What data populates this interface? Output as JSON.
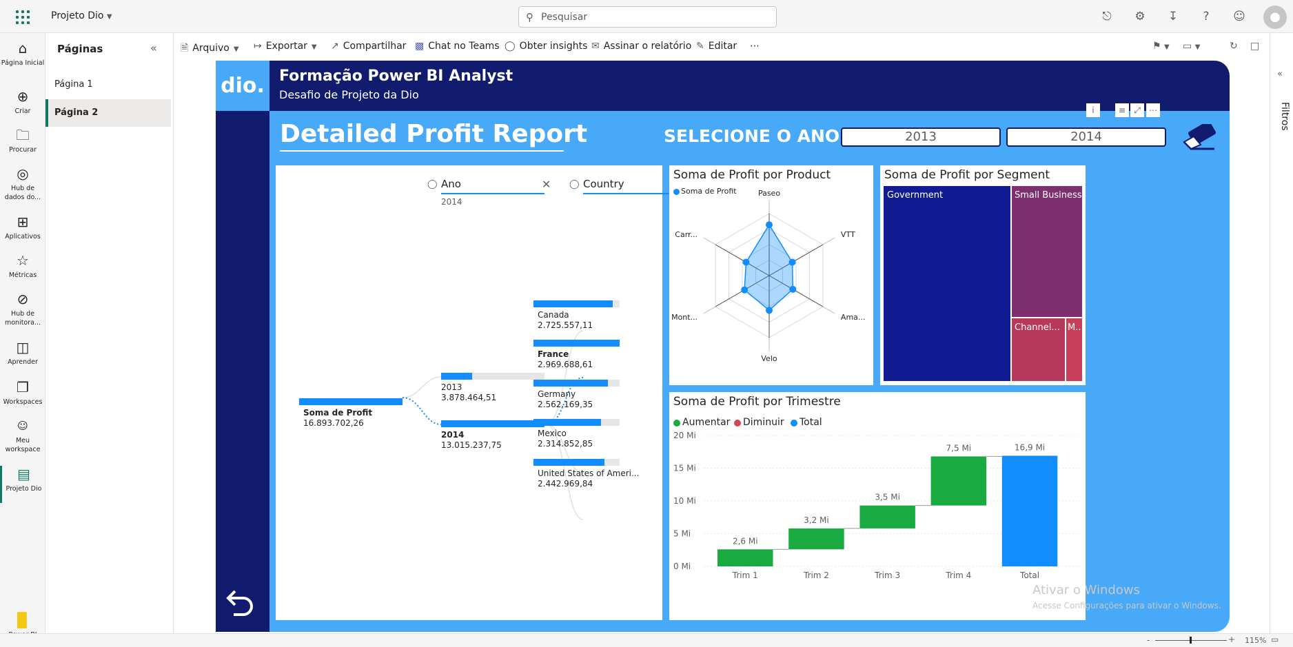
{
  "topbar": {
    "workspace": "Projeto Dio",
    "search_placeholder": "Pesquisar"
  },
  "rail": [
    {
      "icon": "home-icon",
      "label": "Página Inicial"
    },
    {
      "icon": "plus-icon",
      "label": "Criar"
    },
    {
      "icon": "folder-icon",
      "label": "Procurar"
    },
    {
      "icon": "data-hub-icon",
      "label": "Hub de dados do..."
    },
    {
      "icon": "apps-icon",
      "label": "Aplicativos"
    },
    {
      "icon": "trophy-icon",
      "label": "Métricas"
    },
    {
      "icon": "monitor-hub-icon",
      "label": "Hub de monitora..."
    },
    {
      "icon": "book-icon",
      "label": "Aprender"
    },
    {
      "icon": "workspaces-icon",
      "label": "Workspaces"
    },
    {
      "icon": "user-icon",
      "label": "Meu workspace"
    },
    {
      "icon": "report-icon",
      "label": "Projeto Dio"
    }
  ],
  "rail_footer": "Power BI",
  "pages": {
    "title": "Páginas",
    "items": [
      "Página 1",
      "Página 2"
    ]
  },
  "toolbar": {
    "arquivo": "Arquivo",
    "exportar": "Exportar",
    "compartilhar": "Compartilhar",
    "chat": "Chat no Teams",
    "insights": "Obter insights",
    "assinar": "Assinar o relatório",
    "editar": "Editar"
  },
  "filters_label": "Filtros",
  "status": {
    "zoom": "115%"
  },
  "report": {
    "logo": "dio.",
    "title": "Formação Power BI Analyst",
    "subtitle": "Desafio de Projeto da Dio",
    "heading": "Detailed Profit Report",
    "select_label": "SELECIONE O ANO:",
    "years": [
      "2013",
      "2014"
    ],
    "decomposition": {
      "header_ano": "Ano",
      "header_ano_sel": "2014",
      "header_country": "Country",
      "root_label": "Soma de Profit",
      "root_value": "16.893.702,26",
      "years": [
        {
          "label": "2013",
          "value": "3.878.464,51"
        },
        {
          "label": "2014",
          "value": "13.015.237,75"
        }
      ],
      "countries": [
        {
          "label": "Canada",
          "value": "2.725.557,11",
          "share": 0.92
        },
        {
          "label": "France",
          "value": "2.969.688,61",
          "share": 1.0
        },
        {
          "label": "Germany",
          "value": "2.562.169,35",
          "share": 0.86
        },
        {
          "label": "Mexico",
          "value": "2.314.852,85",
          "share": 0.78
        },
        {
          "label": "United States of Ameri...",
          "value": "2.442.969,84",
          "share": 0.82
        }
      ]
    },
    "radar": {
      "title": "Soma de Profit por Product",
      "legend": "Soma de Profit"
    },
    "treemap": {
      "title": "Soma de Profit por Segment",
      "labels": [
        "Government",
        "Small Business",
        "Channel...",
        "M..."
      ]
    },
    "waterfall": {
      "title": "Soma de Profit por Trimestre",
      "legend": [
        "Aumentar",
        "Diminuir",
        "Total"
      ]
    }
  },
  "watermark": {
    "line1": "Ativar o Windows",
    "line2": "Acesse Configurações para ativar o Windows."
  },
  "chart_data": [
    {
      "type": "radar",
      "title": "Soma de Profit por Product",
      "series": [
        {
          "name": "Soma de Profit",
          "values": [
            0.82,
            0.43,
            0.44,
            0.56,
            0.46,
            0.43
          ]
        }
      ],
      "categories": [
        "Paseo",
        "VTT",
        "Ama...",
        "Velo",
        "Mont...",
        "Carr..."
      ]
    },
    {
      "type": "treemap",
      "title": "Soma de Profit por Segment",
      "categories": [
        "Government",
        "Small Business",
        "Channel...",
        "M..."
      ],
      "values": [
        0.6,
        0.26,
        0.09,
        0.05
      ]
    },
    {
      "type": "waterfall",
      "title": "Soma de Profit por Trimestre",
      "categories": [
        "Trim 1",
        "Trim 2",
        "Trim 3",
        "Trim 4",
        "Total"
      ],
      "values": [
        2.6,
        3.2,
        3.5,
        7.5,
        16.9
      ],
      "labels": [
        "2,6 Mi",
        "3,2 Mi",
        "3,5 Mi",
        "7,5 Mi",
        "16,9 Mi"
      ],
      "ylim": [
        0,
        20
      ],
      "yticks": [
        "0 Mi",
        "5 Mi",
        "10 Mi",
        "15 Mi",
        "20 Mi"
      ],
      "colors": {
        "increase": "#1aab40",
        "decrease": "#d64554",
        "total": "#118dff"
      }
    }
  ]
}
